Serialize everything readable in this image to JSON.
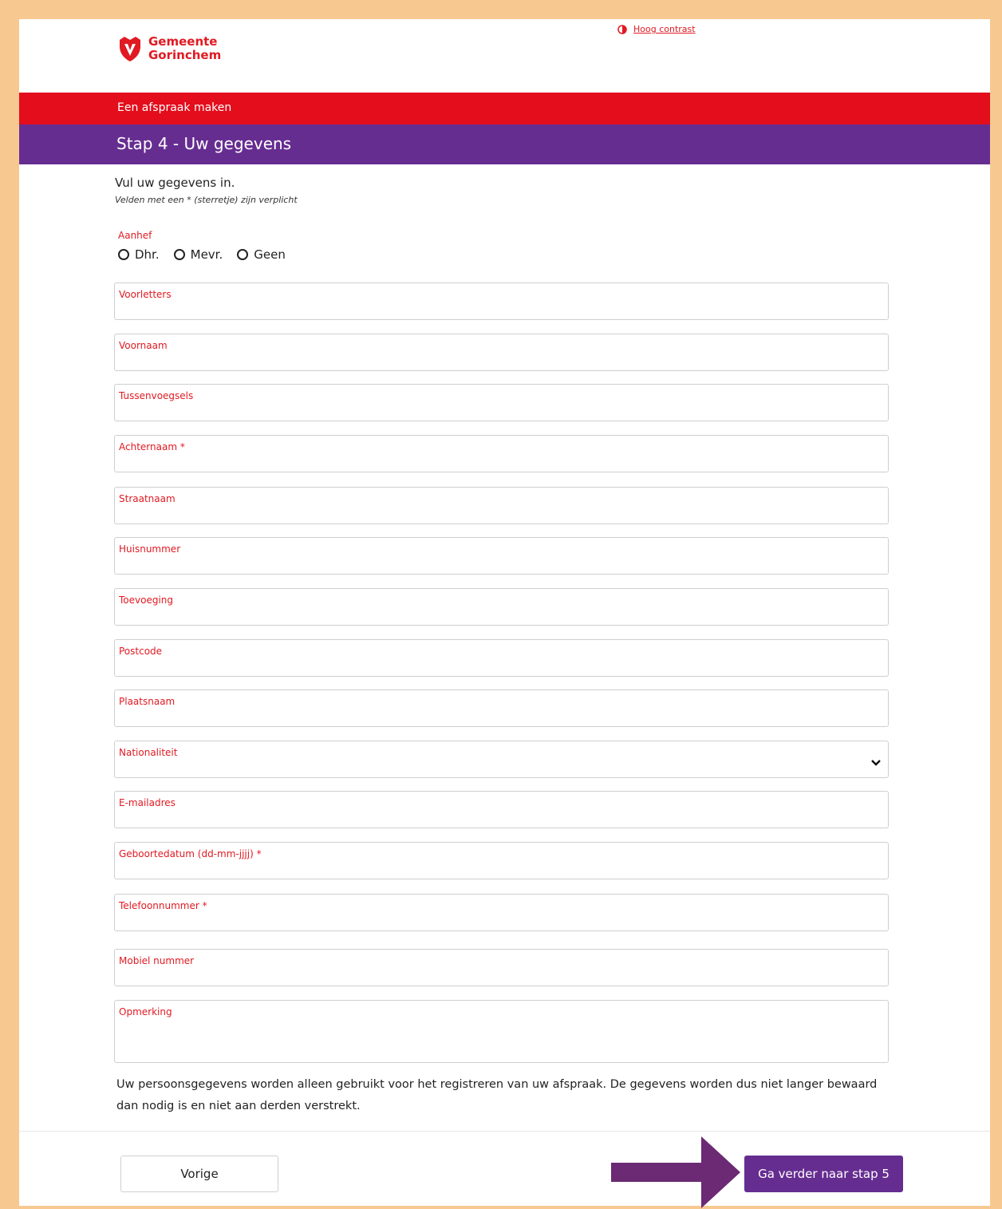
{
  "header": {
    "logo_line1": "Gemeente",
    "logo_line2": "Gorinchem",
    "contrast_link": "Hoog contrast"
  },
  "banner": {
    "title": "Een afspraak maken"
  },
  "step": {
    "title": "Stap 4 - Uw gegevens"
  },
  "intro": {
    "main": "Vul uw gegevens in.",
    "note": "Velden met een * (sterretje) zijn verplicht"
  },
  "aanhef": {
    "label": "Aanhef",
    "options": [
      "Dhr.",
      "Mevr.",
      "Geen"
    ]
  },
  "fields": [
    {
      "label": "Voorletters"
    },
    {
      "label": "Voornaam"
    },
    {
      "label": "Tussenvoegsels"
    },
    {
      "label": "Achternaam *"
    },
    {
      "label": "Straatnaam"
    },
    {
      "label": "Huisnummer"
    },
    {
      "label": "Toevoeging"
    },
    {
      "label": "Postcode"
    },
    {
      "label": "Plaatsnaam"
    },
    {
      "label": "Nationaliteit"
    },
    {
      "label": "E-mailadres"
    },
    {
      "label": "Geboortedatum (dd-mm-jjjj) *"
    },
    {
      "label": "Telefoonnummer *"
    },
    {
      "label": "Mobiel nummer"
    },
    {
      "label": "Opmerking"
    }
  ],
  "privacy": "Uw persoonsgegevens worden alleen gebruikt voor het registreren van uw afspraak. De gegevens worden dus niet langer bewaard dan nodig is en niet aan derden verstrekt.",
  "buttons": {
    "prev": "Vorige",
    "next": "Ga verder naar stap 5"
  },
  "colors": {
    "red": "#e30d1c",
    "purple": "#662d91",
    "frame": "#f7c991"
  }
}
